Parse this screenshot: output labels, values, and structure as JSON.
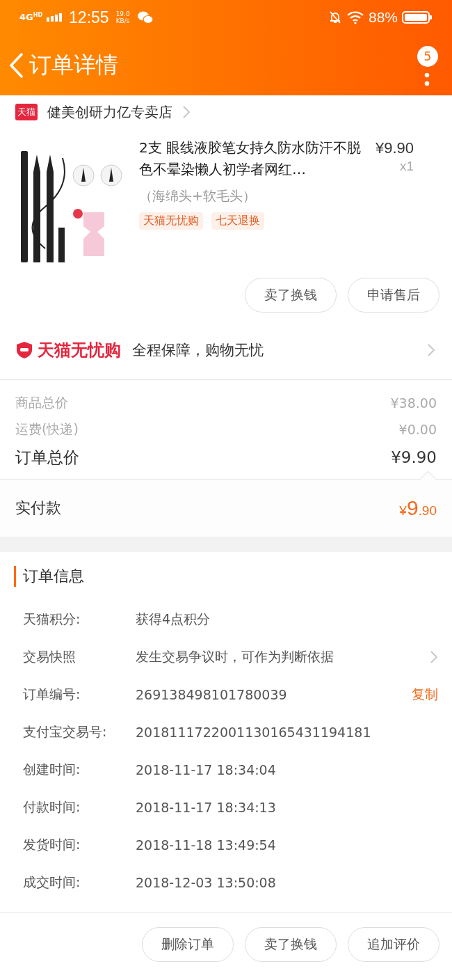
{
  "status_bar": {
    "network": "4G",
    "network_sub": "HD",
    "time": "12:55",
    "speed_value": "19.0",
    "speed_unit": "KB/s",
    "battery": "88%"
  },
  "header": {
    "title": "订单详情",
    "badge": "5"
  },
  "store": {
    "badge": "天猫",
    "name": "健美创研力亿专卖店"
  },
  "product": {
    "kind": "picture",
    "title": "2支 眼线液胶笔女持久防水防汗不脱色不晕染懒人初学者网红…",
    "price": "¥9.90",
    "quantity": "x1",
    "variant": "（海绵头+软毛头）",
    "tags": [
      "天猫无忧购",
      "七天退换"
    ]
  },
  "item_actions": [
    "卖了换钱",
    "申请售后"
  ],
  "guarantee": {
    "brand": "天猫无忧购",
    "text": "全程保障，购物无忧"
  },
  "summary": [
    {
      "label": "商品总价",
      "value": "¥38.00",
      "kind": "minor"
    },
    {
      "label": "运费(快递)",
      "value": "¥0.00",
      "kind": "minor"
    },
    {
      "label": "订单总价",
      "value": "¥9.90",
      "kind": "major"
    }
  ],
  "paid": {
    "label": "实付款",
    "currency": "¥",
    "integer": "9",
    "decimals": ".90"
  },
  "order_info": {
    "title": "订单信息",
    "rows": [
      {
        "label": "天猫积分:",
        "value": "获得4点积分",
        "kind": "plain"
      },
      {
        "label": "交易快照",
        "value": "发生交易争议时，可作为判断依据",
        "kind": "link"
      },
      {
        "label": "订单编号:",
        "value": "269138498101780039",
        "kind": "copy",
        "action": "复制"
      },
      {
        "label": "支付宝交易号:",
        "value": "2018111722001130165431194181",
        "kind": "plain"
      },
      {
        "label": "创建时间:",
        "value": "2018-11-17 18:34:04",
        "kind": "plain"
      },
      {
        "label": "付款时间:",
        "value": "2018-11-17 18:34:13",
        "kind": "plain"
      },
      {
        "label": "发货时间:",
        "value": "2018-11-18 13:49:54",
        "kind": "plain"
      },
      {
        "label": "成交时间:",
        "value": "2018-12-03 13:50:08",
        "kind": "plain"
      }
    ]
  },
  "bottom_actions": [
    "删除订单",
    "卖了换钱",
    "追加评价"
  ]
}
